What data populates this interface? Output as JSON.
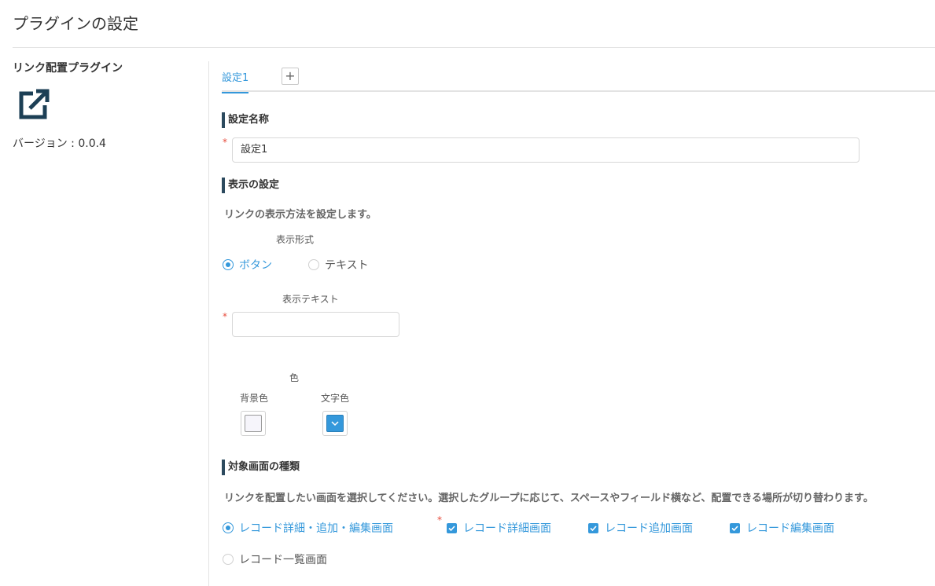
{
  "page": {
    "title": "プラグインの設定"
  },
  "sidebar": {
    "plugin_name": "リンク配置プラグイン",
    "icon": "external-link-icon",
    "version_label": "バージョン : 0.0.4"
  },
  "tabs": {
    "items": [
      {
        "label": "設定1"
      }
    ],
    "add_label": "+"
  },
  "setting_name": {
    "heading": "設定名称",
    "required_mark": "*",
    "value": "設定1"
  },
  "display": {
    "heading": "表示の設定",
    "description": "リンクの表示方法を設定します。",
    "format": {
      "label": "表示形式",
      "options": [
        {
          "label": "ボタン",
          "checked": true
        },
        {
          "label": "テキスト",
          "checked": false
        }
      ]
    },
    "text": {
      "label": "表示テキスト",
      "required_mark": "*",
      "value": ""
    },
    "color": {
      "label": "色",
      "background": {
        "label": "背景色",
        "value": "#f6f5fb"
      },
      "text": {
        "label": "文字色",
        "value": "#3498db"
      }
    }
  },
  "target": {
    "heading": "対象画面の種類",
    "description": "リンクを配置したい画面を選択してください。選択したグループに応じて、スペースやフィールド横など、配置できる場所が切り替わります。",
    "groups": [
      {
        "label": "レコード詳細・追加・編集画面",
        "checked": true
      },
      {
        "label": "レコード一覧画面",
        "checked": false
      }
    ],
    "required_mark": "*",
    "screens": [
      {
        "label": "レコード詳細画面",
        "checked": true
      },
      {
        "label": "レコード追加画面",
        "checked": true
      },
      {
        "label": "レコード編集画面",
        "checked": true
      }
    ]
  },
  "colors": {
    "accent": "#3498db",
    "heading_bar": "#2c4a5e",
    "required": "#e74c3c"
  }
}
